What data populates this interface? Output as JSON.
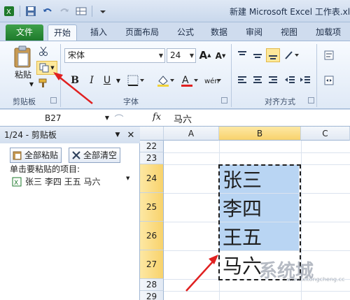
{
  "window": {
    "title": "新建 Microsoft Excel 工作表.xls"
  },
  "tabs": [
    "文件",
    "开始",
    "插入",
    "页面布局",
    "公式",
    "数据",
    "审阅",
    "视图",
    "加载项"
  ],
  "ribbon": {
    "clipboard": {
      "paste_label": "粘贴",
      "group_label": "剪贴板"
    },
    "font": {
      "name": "宋体",
      "size": "24",
      "bold": "B",
      "italic": "I",
      "underline": "U",
      "group_label": "字体"
    },
    "alignment": {
      "group_label": "对齐方式"
    }
  },
  "formula_bar": {
    "name_box": "B27",
    "fx_label": "fx",
    "content": "马六"
  },
  "clipboard_pane": {
    "title": "1/24 - 剪贴板",
    "paste_all": "全部粘贴",
    "clear_all": "全部清空",
    "hint": "单击要粘贴的项目:",
    "items": [
      "张三 李四 王五 马六"
    ]
  },
  "sheet": {
    "columns": [
      "A",
      "B",
      "C"
    ],
    "rows": [
      "22",
      "23",
      "24",
      "25",
      "26",
      "27",
      "28",
      "29"
    ],
    "cells": [
      "张三",
      "李四",
      "王五",
      "马六"
    ]
  },
  "watermark": {
    "text": "系统城",
    "url": "www.xitongcheng.cc"
  },
  "colors": {
    "accent": "#1e7a2b",
    "selection": "#b9d5f3",
    "header_highlight": "#f8d26b",
    "arrow": "#e02020"
  }
}
